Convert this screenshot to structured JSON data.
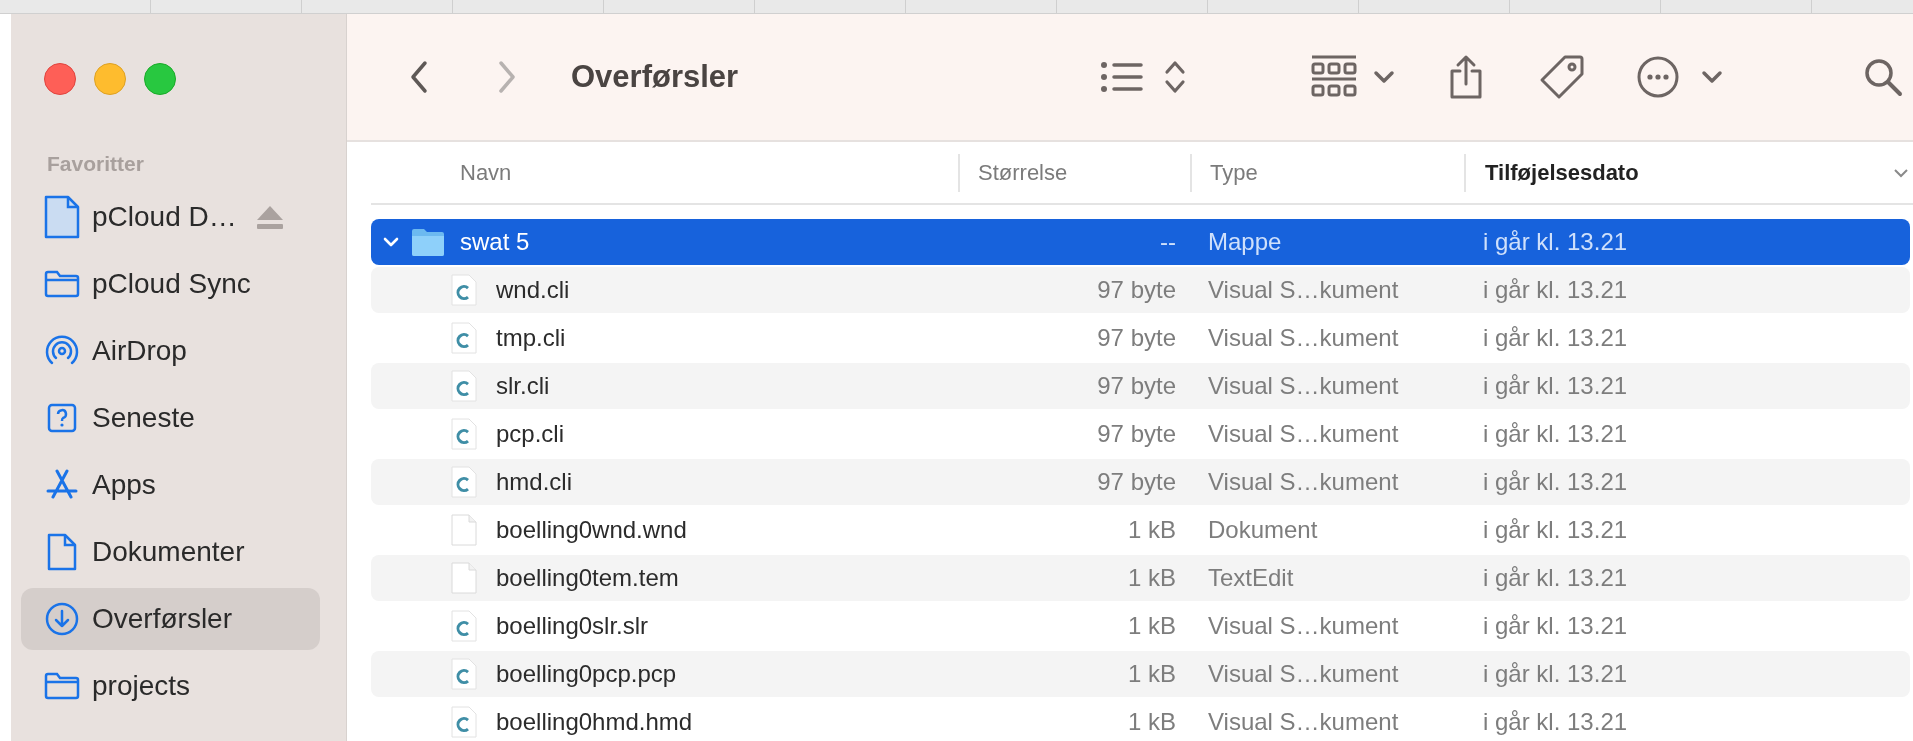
{
  "window": {
    "title": "Overførsler"
  },
  "toolbar": {
    "back": {
      "disabled": false
    },
    "forward": {
      "disabled": true
    }
  },
  "sidebar": {
    "section": "Favoritter",
    "items": [
      {
        "label": "pCloud D…",
        "kind": "drive",
        "selected": false,
        "ejectable": true
      },
      {
        "label": "pCloud Sync",
        "kind": "folder",
        "selected": false,
        "ejectable": false
      },
      {
        "label": "AirDrop",
        "kind": "airdrop",
        "selected": false,
        "ejectable": false
      },
      {
        "label": "Seneste",
        "kind": "recent",
        "selected": false,
        "ejectable": false
      },
      {
        "label": "Apps",
        "kind": "apps",
        "selected": false,
        "ejectable": false
      },
      {
        "label": "Dokumenter",
        "kind": "document",
        "selected": false,
        "ejectable": false
      },
      {
        "label": "Overførsler",
        "kind": "download",
        "selected": true,
        "ejectable": false
      },
      {
        "label": "projects",
        "kind": "folder",
        "selected": false,
        "ejectable": false
      }
    ]
  },
  "table": {
    "columns": [
      {
        "label": "Navn",
        "sorted": false
      },
      {
        "label": "Størrelse",
        "sorted": false
      },
      {
        "label": "Type",
        "sorted": false
      },
      {
        "label": "Tilføjelsesdato",
        "sorted": true
      }
    ],
    "rows": [
      {
        "name": "swat 5",
        "kind": "folder",
        "size": "--",
        "type": "Mappe",
        "date": "i går kl. 13.21",
        "selected": true,
        "expanded": true,
        "children": [
          {
            "name": "wnd.cli",
            "kind": "c-file",
            "size": "97 byte",
            "type": "Visual S…kument",
            "date": "i går kl. 13.21",
            "selected": false
          },
          {
            "name": "tmp.cli",
            "kind": "c-file",
            "size": "97 byte",
            "type": "Visual S…kument",
            "date": "i går kl. 13.21",
            "selected": false
          },
          {
            "name": "slr.cli",
            "kind": "c-file",
            "size": "97 byte",
            "type": "Visual S…kument",
            "date": "i går kl. 13.21",
            "selected": false
          },
          {
            "name": "pcp.cli",
            "kind": "c-file",
            "size": "97 byte",
            "type": "Visual S…kument",
            "date": "i går kl. 13.21",
            "selected": false
          },
          {
            "name": "hmd.cli",
            "kind": "c-file",
            "size": "97 byte",
            "type": "Visual S…kument",
            "date": "i går kl. 13.21",
            "selected": false
          },
          {
            "name": "boelling0wnd.wnd",
            "kind": "blank-file",
            "size": "1 kB",
            "type": "Dokument",
            "date": "i går kl. 13.21",
            "selected": false
          },
          {
            "name": "boelling0tem.tem",
            "kind": "blank-file",
            "size": "1 kB",
            "type": "TextEdit",
            "date": "i går kl. 13.21",
            "selected": false
          },
          {
            "name": "boelling0slr.slr",
            "kind": "c-file",
            "size": "1 kB",
            "type": "Visual S…kument",
            "date": "i går kl. 13.21",
            "selected": false
          },
          {
            "name": "boelling0pcp.pcp",
            "kind": "c-file",
            "size": "1 kB",
            "type": "Visual S…kument",
            "date": "i går kl. 13.21",
            "selected": false
          },
          {
            "name": "boelling0hmd.hmd",
            "kind": "c-file",
            "size": "1 kB",
            "type": "Visual S…kument",
            "date": "i går kl. 13.21",
            "selected": false
          }
        ]
      }
    ]
  }
}
